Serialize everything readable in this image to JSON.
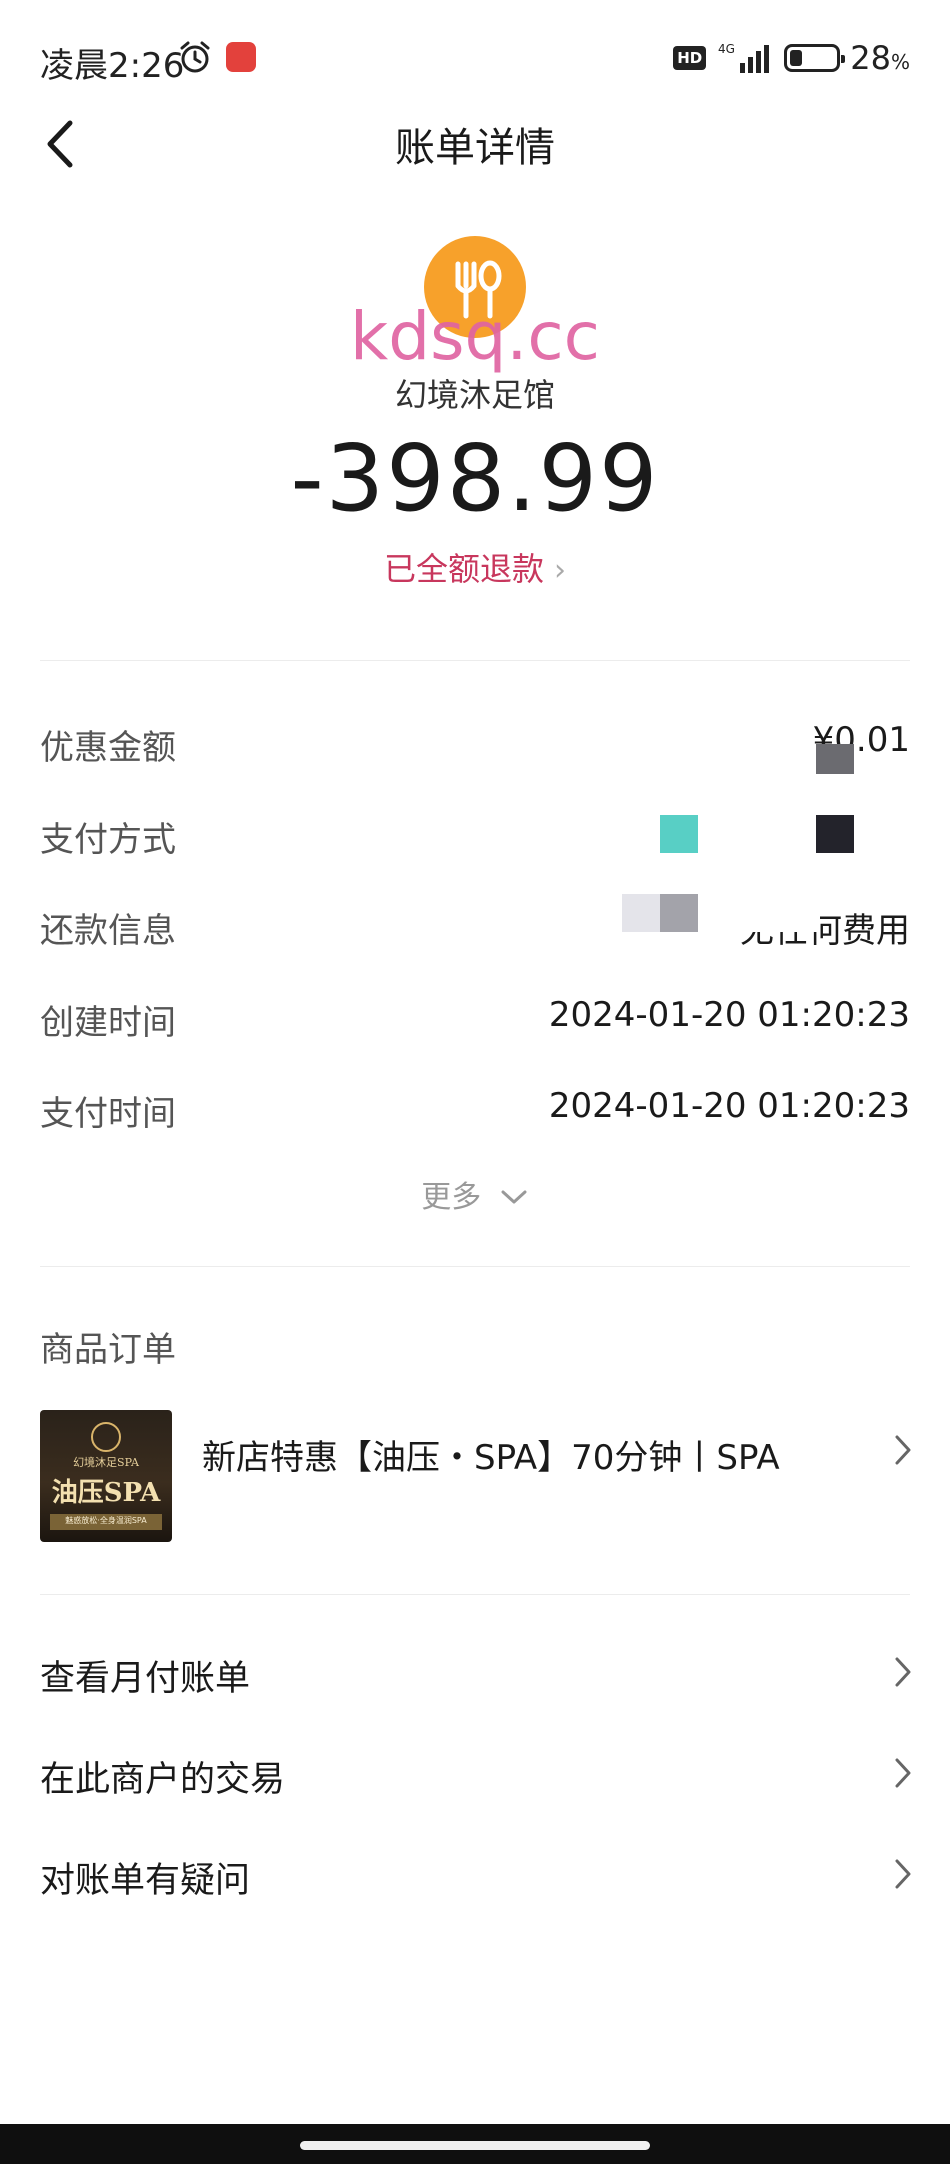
{
  "status_bar": {
    "time": "凌晨2:26",
    "hd_badge": "HD",
    "network": "4G",
    "battery_percent_text": "28",
    "battery_unit": "%",
    "battery_level": 0.28
  },
  "header": {
    "title": "账单详情",
    "back_icon": "chevron-left-icon"
  },
  "merchant": {
    "watermark": "kdsq.cc",
    "name": "幻境沐足馆",
    "logo_icon": "fork-spoon-icon",
    "logo_color": "#f7a12b",
    "amount": "-398.99",
    "refund_status": "已全额退款",
    "refund_color": "#c8375d"
  },
  "details": {
    "rows": [
      {
        "label": "优惠金额",
        "value": "¥0.01"
      },
      {
        "label": "支付方式",
        "value": ""
      },
      {
        "label": "还款信息",
        "value": "无任何费用"
      },
      {
        "label": "创建时间",
        "value": "2024-01-20 01:20:23"
      },
      {
        "label": "支付时间",
        "value": "2024-01-20 01:20:23"
      }
    ],
    "more_label": "更多"
  },
  "order": {
    "section_title": "商品订单",
    "thumb_subtitle": "幻境沐足SPA",
    "thumb_title": "油压SPA",
    "thumb_footer": "魅惑放松·全身温润SPA",
    "item_name": "新店特惠【油压・SPA】70分钟丨SPA"
  },
  "links": [
    {
      "label": "查看月付账单"
    },
    {
      "label": "在此商户的交易"
    },
    {
      "label": "对账单有疑问"
    }
  ]
}
